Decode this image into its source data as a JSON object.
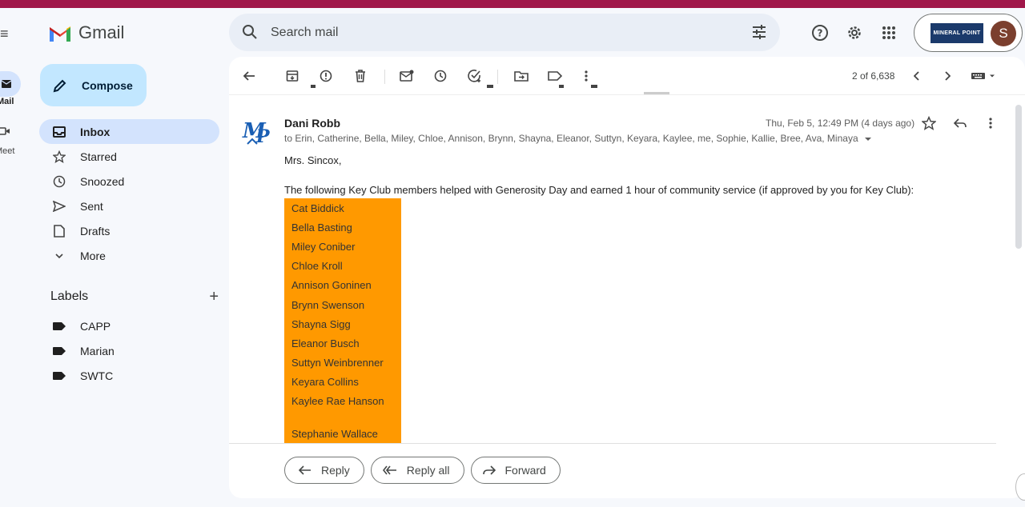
{
  "app": {
    "name": "Gmail",
    "rail": {
      "mail_label": "Mail",
      "meet_label": "Meet"
    }
  },
  "search": {
    "placeholder": "Search mail"
  },
  "account": {
    "org_logo_text": "MINERAL POINT",
    "avatar_initial": "S"
  },
  "sidebar": {
    "compose_label": "Compose",
    "nav": [
      {
        "label": "Inbox",
        "icon": "inbox-icon",
        "active": true
      },
      {
        "label": "Starred",
        "icon": "star-icon"
      },
      {
        "label": "Snoozed",
        "icon": "clock-icon"
      },
      {
        "label": "Sent",
        "icon": "send-icon"
      },
      {
        "label": "Drafts",
        "icon": "draft-icon"
      },
      {
        "label": "More",
        "icon": "chevron-down-icon"
      }
    ],
    "labels_title": "Labels",
    "labels": [
      {
        "label": "CAPP"
      },
      {
        "label": "Marian"
      },
      {
        "label": "SWTC"
      }
    ]
  },
  "toolbar": {
    "page_count": "2 of 6,638"
  },
  "message": {
    "sender": "Dani Robb",
    "date": "Thu, Feb 5, 12:49 PM (4 days ago)",
    "recipients": "to Erin, Catherine, Bella, Miley, Chloe, Annison, Brynn, Shayna, Eleanor, Suttyn, Keyara, Kaylee, me, Sophie, Kallie, Bree, Ava, Minaya",
    "greeting": "Mrs. Sincox,",
    "intro": "The following Key Club members helped with Generosity Day and earned 1 hour of community service (if approved by you for Key Club):",
    "names": [
      "Cat Biddick",
      "Bella Basting",
      "Miley Coniber",
      "Chloe Kroll",
      "Annison Goninen",
      "Brynn Swenson",
      "Shayna Sigg",
      "Eleanor Busch",
      "Suttyn Weinbrenner",
      "Keyara Collins",
      "Kaylee Rae Hanson"
    ],
    "name_last": "Stephanie Wallace",
    "highlight_color": "#ff9900"
  },
  "actions": {
    "reply": "Reply",
    "reply_all": "Reply all",
    "forward": "Forward"
  },
  "colors": {
    "brand_strip": "#a0174a",
    "compose_bg": "#c2e7ff",
    "active_nav": "#d3e3fd"
  }
}
